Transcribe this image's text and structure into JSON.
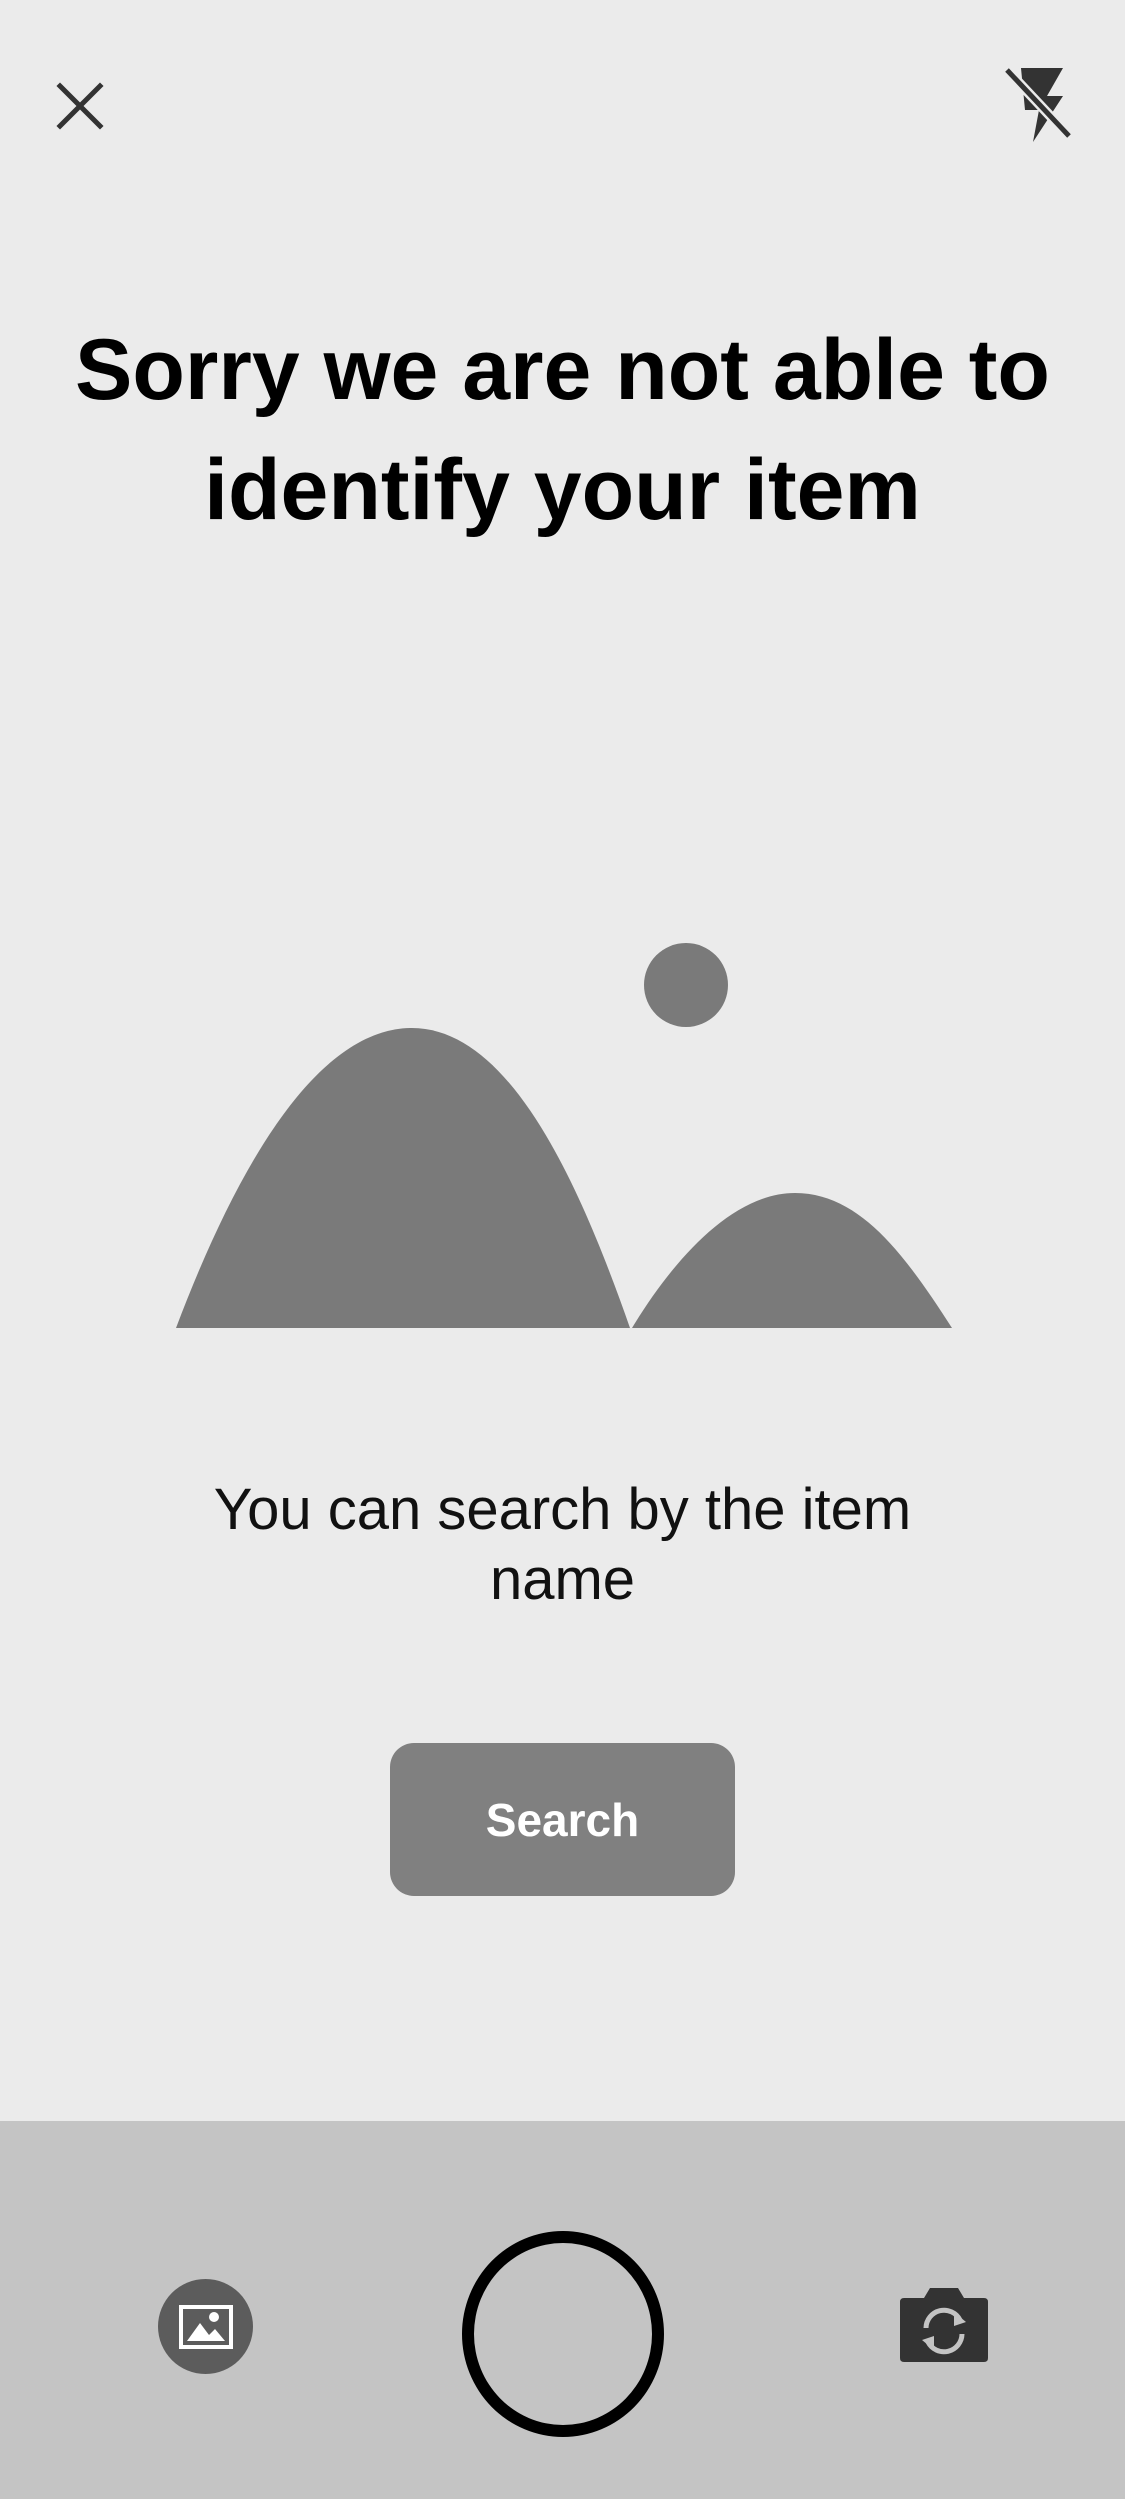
{
  "top_bar": {
    "close_icon": "close-icon",
    "flash_icon": "flash-off-icon"
  },
  "message": {
    "title": "Sorry we are not able to identify your item",
    "hint": "You can search by the item name"
  },
  "illustration": {
    "icon": "image-placeholder-icon",
    "color": "#7a7a7a"
  },
  "search_button": {
    "label": "Search",
    "color": "#808080"
  },
  "bottom_bar": {
    "background": "#c4c4c4",
    "gallery_icon": "gallery-icon",
    "shutter_icon": "shutter-icon",
    "flip_camera_icon": "flip-camera-icon"
  }
}
